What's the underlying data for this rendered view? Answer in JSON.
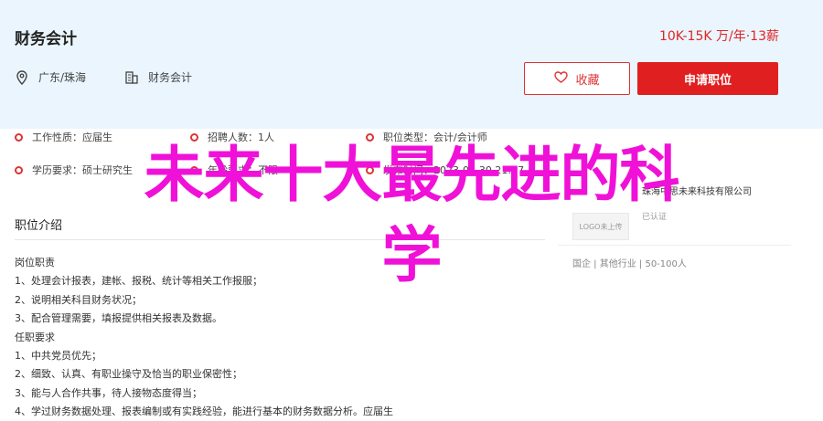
{
  "job": {
    "title": "财务会计",
    "salary": "10K-15K 万/年·13薪",
    "location": "广东/珠海",
    "category": "财务会计"
  },
  "actions": {
    "favorite_label": "收藏",
    "apply_label": "申请职位"
  },
  "details": {
    "row1": [
      {
        "label": "工作性质：",
        "value": "应届生"
      },
      {
        "label": "招聘人数：",
        "value": "1人"
      },
      {
        "label": "职位类型：",
        "value": "会计/会计师"
      }
    ],
    "row2": [
      {
        "label": "学历要求：",
        "value": "硕士研究生"
      },
      {
        "label": "年龄要求：",
        "value": "不限"
      },
      {
        "label": "发布时间：",
        "value": "2023-06-30 21:27"
      }
    ]
  },
  "description": {
    "section_title": "职位介绍",
    "lines": [
      "岗位职责",
      "1、处理会计报表，建帐、报税、统计等相关工作报服；",
      "2、说明相关科目财务状况；",
      "3、配合管理需要，填报提供相关报表及数据。",
      "任职要求",
      "1、中共党员优先；",
      "2、细致、认真、有职业操守及恰当的职业保密性；",
      "3、能与人合作共事，待人接物态度得当；",
      "4、学过财务数据处理、报表编制或有实践经验，能进行基本的财务数据分析。应届生"
    ]
  },
  "company": {
    "name": "珠海中思未来科技有限公司",
    "logo_text": "LOGO未上传",
    "verify_text": "已认证",
    "meta": "国企 | 其他行业 | 50-100人"
  },
  "watermark": {
    "line1": "未来十大最先进的科",
    "line2": "学"
  },
  "colors": {
    "accent": "#e02020",
    "header_bg": "#eaf5fd",
    "watermark": "#f011d8"
  }
}
